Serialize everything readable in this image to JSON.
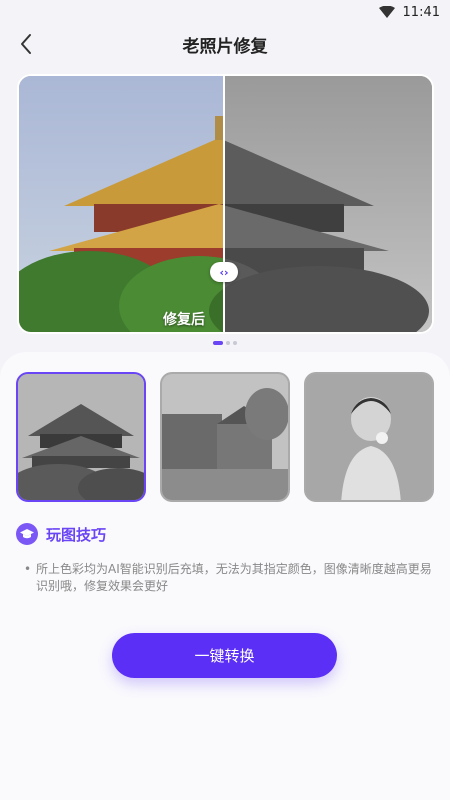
{
  "status_bar": {
    "time": "11:41"
  },
  "header": {
    "title": "老照片修复"
  },
  "compare": {
    "after_label": "修复后",
    "handle_glyph": "‹›"
  },
  "carousel": {
    "pages": 3,
    "active": 0
  },
  "thumbnails": [
    {
      "name": "palace",
      "selected": true
    },
    {
      "name": "street",
      "selected": false
    },
    {
      "name": "child",
      "selected": false
    }
  ],
  "tips": {
    "title": "玩图技巧",
    "bullet": "•",
    "text": "所上色彩均为AI智能识别后充填，无法为其指定颜色，图像清晰度越高更易识别哦，修复效果会更好"
  },
  "actions": {
    "convert_label": "一键转换"
  },
  "colors": {
    "accent": "#5b2ff5",
    "accent_light": "#6a45f5"
  }
}
